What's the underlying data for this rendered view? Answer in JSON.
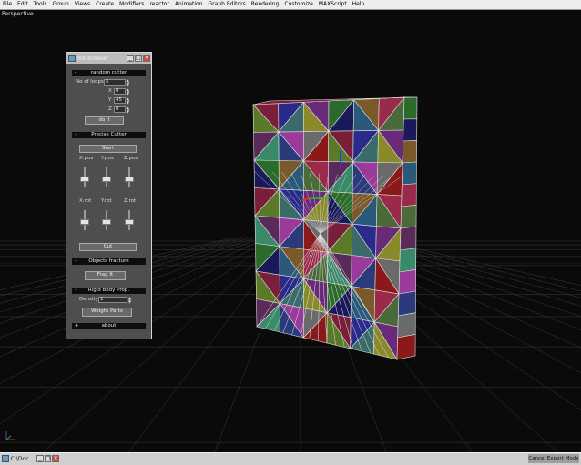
{
  "menu": [
    "File",
    "Edit",
    "Tools",
    "Group",
    "Views",
    "Create",
    "Modifiers",
    "reactor",
    "Animation",
    "Graph Editors",
    "Rendering",
    "Customize",
    "MAXScript",
    "Help"
  ],
  "viewport": {
    "label": "Perspective"
  },
  "dialog": {
    "title": "Blk Breaker",
    "random_cutter": {
      "header": "random cutter",
      "sign": "–",
      "loops_label": "No of loops",
      "loops_value": "5",
      "x_label": "X",
      "x_value": "0",
      "y_label": "Y",
      "y_value": "45",
      "z_label": "Z",
      "z_value": "0",
      "do_it": "do it"
    },
    "precise_cutter": {
      "header": "Precise Cutter",
      "sign": "–",
      "start": "Start",
      "xpos": "X.pos",
      "ypos": "Y.pos",
      "zpos": "Z.pos",
      "xrot": "X.rot",
      "yrot": "Y.rot",
      "zrot": "Z.rot",
      "cut": "Cut"
    },
    "objects_fracture": {
      "header": "Objects fracture",
      "sign": "–",
      "frag": "Frag It"
    },
    "rigid_body": {
      "header": "Rigid Body Prop.",
      "sign": "–",
      "density_label": "Density",
      "density_value": "1",
      "weight": "Weight Parts"
    },
    "about": {
      "header": "about",
      "sign": "+"
    }
  },
  "taskbar": {
    "task_label": "C:\\Doc..."
  },
  "status": "Cancel Expert Mode",
  "colors": {
    "menubar": "#eeeeee",
    "viewport_bg": "#0a0a0a",
    "dialog_bg": "#4e4e4e",
    "rollout": "#0d0d0d",
    "grid": "#3a3a3a",
    "wire": "#e0e0e0"
  }
}
